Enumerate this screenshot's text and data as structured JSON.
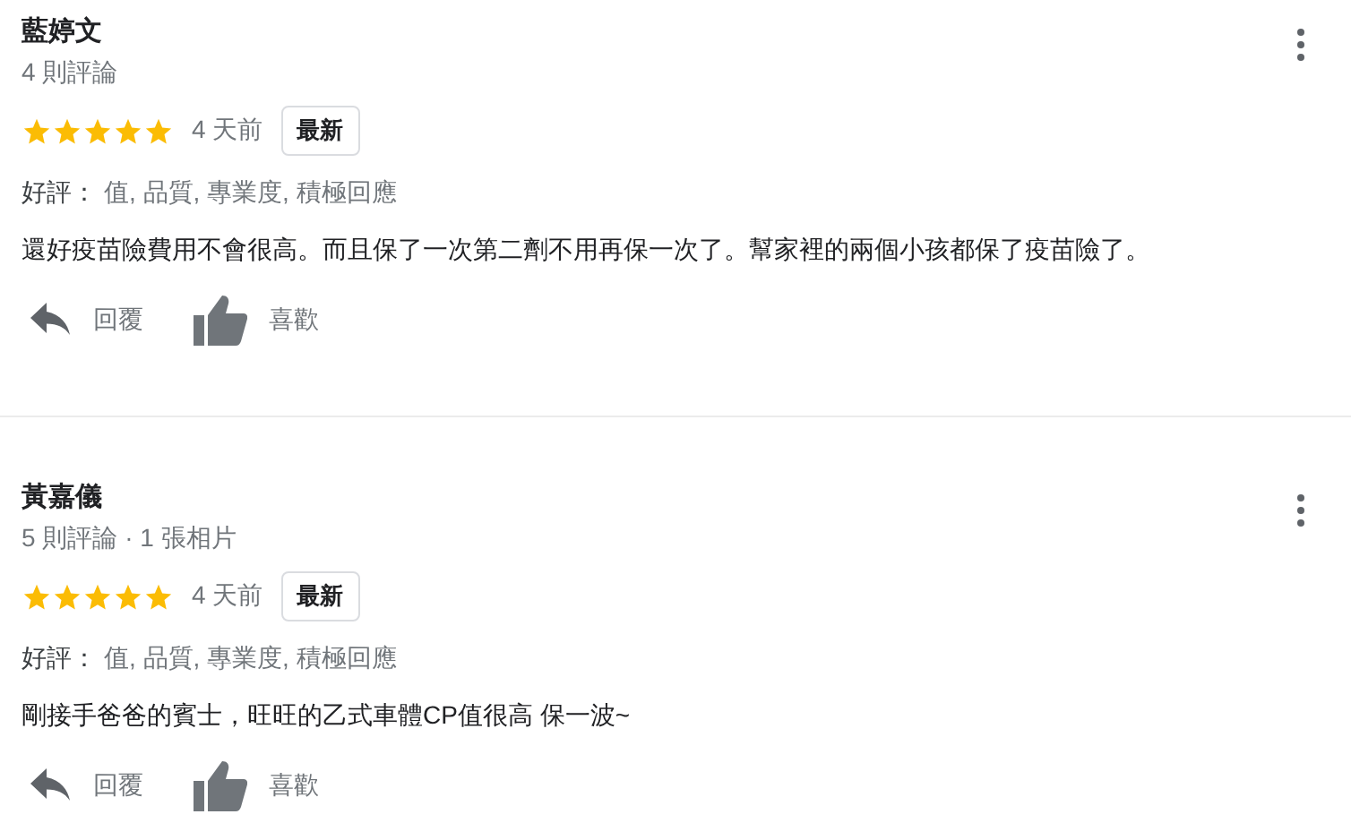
{
  "reviews": [
    {
      "name": "藍婷文",
      "meta": "4 則評論",
      "stars": 5,
      "time": "4 天前",
      "badge": "最新",
      "tags_label": "好評：",
      "tags": "值, 品質, 專業度, 積極回應",
      "text": "還好疫苗險費用不會很高。而且保了一次第二劑不用再保一次了。幫家裡的兩個小孩都保了疫苗險了。",
      "reply": "回覆",
      "like": "喜歡"
    },
    {
      "name": "黃嘉儀",
      "meta": "5 則評論 · 1 張相片",
      "stars": 5,
      "time": "4 天前",
      "badge": "最新",
      "tags_label": "好評：",
      "tags": "值, 品質, 專業度, 積極回應",
      "text": "剛接手爸爸的賓士，旺旺的乙式車體CP值很高 保一波~",
      "reply": "回覆",
      "like": "喜歡"
    }
  ]
}
